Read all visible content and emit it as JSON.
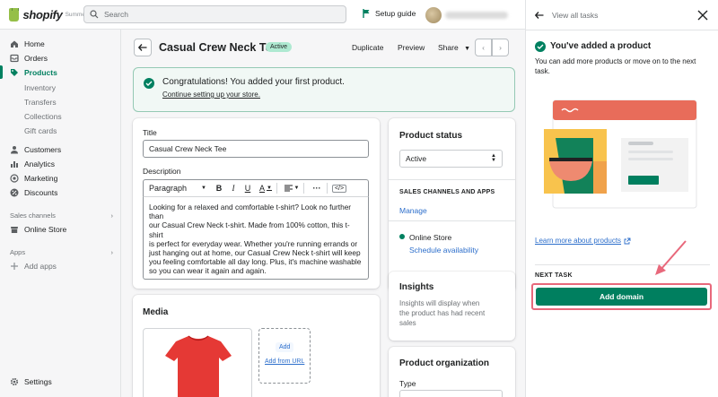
{
  "topbar": {
    "logo": "shopify",
    "logo_sub": "Summe",
    "search_placeholder": "Search",
    "setup_guide": "Setup guide"
  },
  "sidebar": {
    "items": [
      {
        "label": "Home",
        "icon": "home-icon"
      },
      {
        "label": "Orders",
        "icon": "orders-icon"
      },
      {
        "label": "Products",
        "icon": "tag-icon"
      }
    ],
    "sub_items": [
      "Inventory",
      "Transfers",
      "Collections",
      "Gift cards"
    ],
    "items2": [
      {
        "label": "Customers",
        "icon": "person-icon"
      },
      {
        "label": "Analytics",
        "icon": "bar-chart-icon"
      },
      {
        "label": "Marketing",
        "icon": "target-icon"
      },
      {
        "label": "Discounts",
        "icon": "discount-icon"
      }
    ],
    "sales_channels_label": "Sales channels",
    "online_store": "Online Store",
    "apps_label": "Apps",
    "add_apps": "Add apps",
    "settings": "Settings"
  },
  "product": {
    "title": "Casual Crew Neck Tee",
    "status_badge": "Active",
    "actions": [
      "Duplicate",
      "Preview",
      "Share"
    ]
  },
  "banner": {
    "title": "Congratulations! You added your first product.",
    "link": "Continue setting up your store."
  },
  "form": {
    "title_label": "Title",
    "title_value": "Casual Crew Neck Tee",
    "description_label": "Description",
    "paragraph": "Paragraph",
    "description_lines": [
      "Looking for a relaxed and comfortable t-shirt? Look no further than",
      "our Casual Crew Neck t-shirt. Made from 100% cotton, this t-shirt",
      "is perfect for everyday wear. Whether you're running errands or",
      "just hanging out at home, our Casual Crew Neck t-shirt will keep",
      "you feeling comfortable all day long. Plus, it's machine washable",
      "so you can wear it again and again."
    ],
    "media_label": "Media",
    "add_label": "Add",
    "add_from_url": "Add from URL"
  },
  "status_card": {
    "title": "Product status",
    "select_value": "Active",
    "channels_label": "SALES CHANNELS AND APPS",
    "manage": "Manage",
    "online_store": "Online Store",
    "schedule": "Schedule availability"
  },
  "insights": {
    "title": "Insights",
    "lines": [
      "Insights will display when",
      "the product has had recent",
      "sales"
    ]
  },
  "organization": {
    "title": "Product organization",
    "type_label": "Type"
  },
  "panel": {
    "back_label": "View all tasks",
    "done_title": "You've added a product",
    "done_text": "You can add more products or move on to the next task.",
    "learn_more": "Learn more about products",
    "next_task": "NEXT TASK",
    "add_domain": "Add domain"
  },
  "colors": {
    "brand_green": "#008060",
    "highlight": "#e8687b",
    "link": "#2c6ecb"
  }
}
